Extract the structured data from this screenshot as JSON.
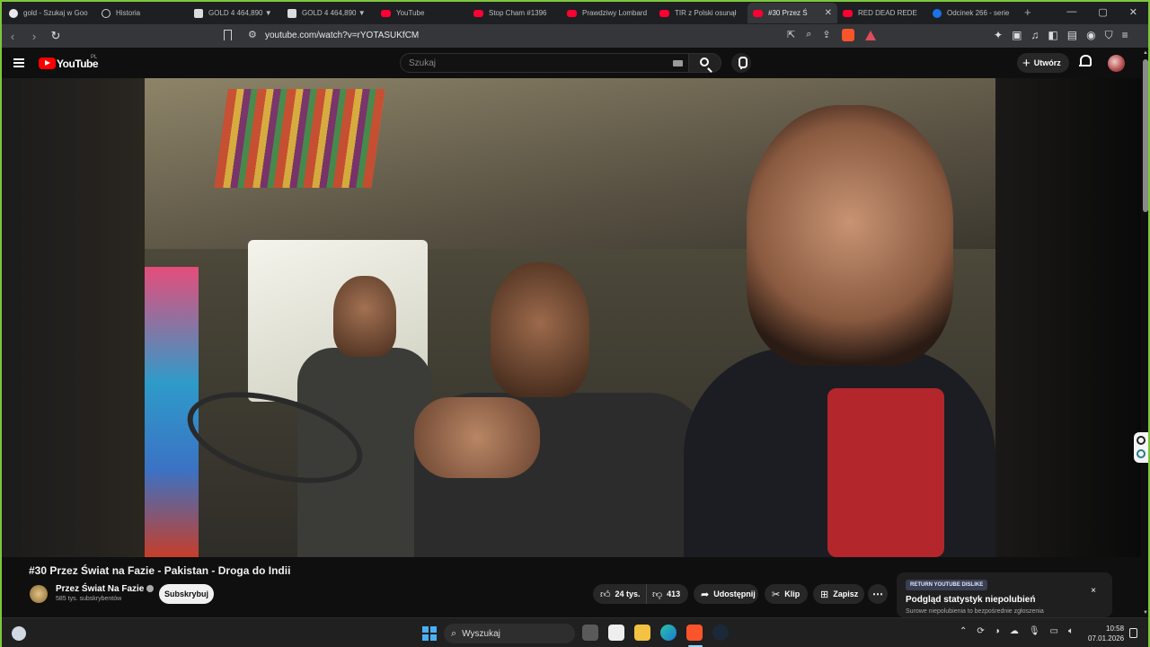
{
  "browser": {
    "tabs": [
      {
        "label": "gold - Szukaj w Goo",
        "icon": "google-icon"
      },
      {
        "label": "Historia",
        "icon": "history-icon"
      },
      {
        "label": "GOLD 4 464,890 ▼",
        "icon": "tradingview-icon"
      },
      {
        "label": "GOLD 4 464,890 ▼",
        "icon": "tradingview-icon"
      },
      {
        "label": "YouTube",
        "icon": "youtube-icon"
      },
      {
        "label": "Stop Cham #1396",
        "icon": "youtube-icon"
      },
      {
        "label": "Prawdziwy Lombard",
        "icon": "youtube-icon"
      },
      {
        "label": "TIR z Polski osunął",
        "icon": "youtube-icon"
      },
      {
        "label": "#30 Przez Ś",
        "icon": "youtube-icon",
        "active": true
      },
      {
        "label": "RED DEAD REDE",
        "icon": "youtube-icon"
      },
      {
        "label": "Odcinek 266 - serie",
        "icon": "p-icon"
      }
    ],
    "new_tab": "+",
    "url": "youtube.com/watch?v=rYOTASUKfCM",
    "window_controls": [
      "—",
      "▢",
      "✕"
    ]
  },
  "youtube": {
    "logo_text": "YouTube",
    "country": "PL",
    "search_placeholder": "Szukaj",
    "create_label": "Utwórz"
  },
  "video": {
    "title": "#30 Przez Świat na Fazie - Pakistan - Droga do Indii",
    "channel": {
      "name": "Przez Świat Na Fazie",
      "subscribers": "585 tys. subskrybentów",
      "subscribe_label": "Subskrybuj"
    },
    "actions": {
      "likes": "24 tys.",
      "dislikes": "413",
      "share": "Udostępnij",
      "clip": "Klip",
      "save": "Zapisz",
      "more": "⋯"
    }
  },
  "ryd_popup": {
    "badge": "RETURN YOUTUBE DISLIKE",
    "title": "Podgląd statystyk niepolubień",
    "subtitle": "Surowe niepolubienia to bezpośrednie zgłoszenia",
    "close": "×"
  },
  "taskbar": {
    "search_label": "Wyszukaj",
    "time": "10:58",
    "date": "07.01.2026"
  },
  "colors": {
    "youtube_red": "#ff0000",
    "window_border": "#7dc63c",
    "background": "#0f0f0f"
  }
}
